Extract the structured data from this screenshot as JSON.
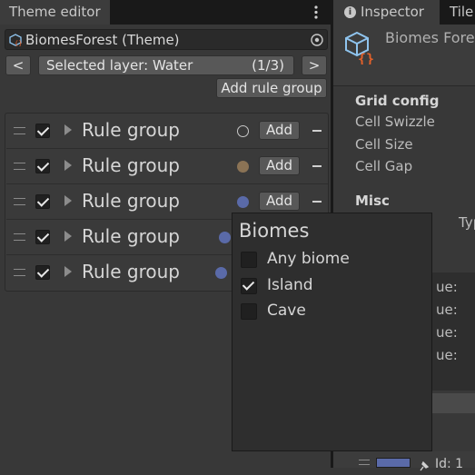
{
  "theme_editor": {
    "tab_title": "Theme editor",
    "theme_field": "BiomesForest (Theme)",
    "prev_label": "<",
    "next_label": ">",
    "layer_label": "Selected layer: Water",
    "layer_count": "(1/3)",
    "add_rule_group_label": "Add rule group",
    "rule_groups": [
      {
        "label": "Rule group",
        "checked": true,
        "dot_color": "none",
        "add_label": "Add"
      },
      {
        "label": "Rule group",
        "checked": true,
        "dot_color": "#8b7355",
        "add_label": "Add"
      },
      {
        "label": "Rule group",
        "checked": true,
        "dot_color": "#5a6aa8",
        "add_label": "Add"
      },
      {
        "label": "Rule group",
        "checked": true,
        "dot_color": "#5a6aa8"
      },
      {
        "label": "Rule group",
        "checked": true,
        "dot_color": "#5a6aa8"
      }
    ]
  },
  "inspector": {
    "tab_title": "Inspector",
    "tab2_title": "Tile",
    "object_name": "Biomes Fore",
    "grid_config_heading": "Grid config",
    "cell_swizzle": "Cell Swizzle",
    "cell_size": "Cell Size",
    "cell_gap": "Cell Gap",
    "misc_heading": "Misc",
    "partial_typ": "Typ",
    "partial_ue": [
      "ue:",
      "ue:",
      "ue:",
      "ue:"
    ],
    "bottom_id": "Id: 1"
  },
  "biomes_popup": {
    "title": "Biomes",
    "options": [
      {
        "label": "Any biome",
        "checked": false
      },
      {
        "label": "Island",
        "checked": true
      },
      {
        "label": "Cave",
        "checked": false
      }
    ]
  }
}
